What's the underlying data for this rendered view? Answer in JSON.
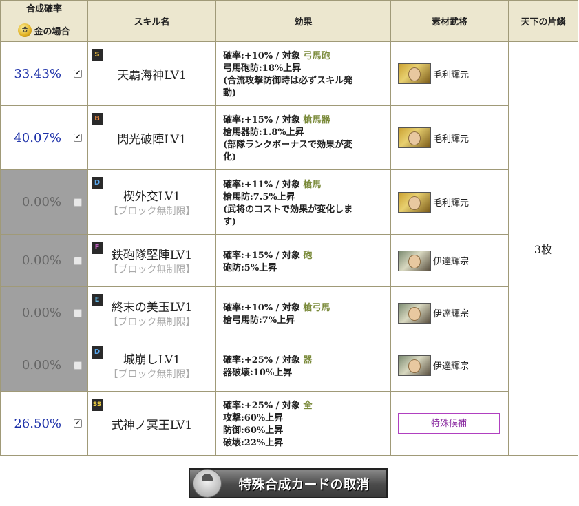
{
  "header": {
    "rate_title": "合成確率",
    "rate_gold": "金の場合",
    "gold_icon": "金",
    "skill_name": "スキル名",
    "effect": "効果",
    "material": "素材武将",
    "fragment": "天下の片鱗"
  },
  "fragment_value": "3枚",
  "rows": [
    {
      "rate": "33.43%",
      "checked": true,
      "rank": "S",
      "skill": "天覇海神LV1",
      "block_note": "",
      "effect": {
        "line1_prefix": "確率:+10% / 対象 ",
        "target": "弓馬砲",
        "lines": [
          "弓馬砲防:18%上昇",
          "(合流攻撃防御時は必ずスキル発",
          "動)"
        ]
      },
      "general": "毛利輝元"
    },
    {
      "rate": "40.07%",
      "checked": true,
      "rank": "B",
      "skill": "閃光破陣LV1",
      "block_note": "",
      "effect": {
        "line1_prefix": "確率:+15% / 対象 ",
        "target": "槍馬器",
        "lines": [
          "槍馬器防:1.8%上昇",
          "(部隊ランクボーナスで効果が変",
          "化)"
        ]
      },
      "general": "毛利輝元"
    },
    {
      "rate": "0.00%",
      "checked": false,
      "rank": "D",
      "skill": "楔外交LV1",
      "block_note": "【ブロック無制限】",
      "effect": {
        "line1_prefix": "確率:+11% / 対象 ",
        "target": "槍馬",
        "lines": [
          "槍馬防:7.5%上昇",
          "(武将のコストで効果が変化しま",
          "す)"
        ]
      },
      "general": "毛利輝元"
    },
    {
      "rate": "0.00%",
      "checked": false,
      "rank": "F",
      "skill": "鉄砲隊堅陣LV1",
      "block_note": "【ブロック無制限】",
      "effect": {
        "line1_prefix": "確率:+15% / 対象 ",
        "target": "砲",
        "lines": [
          "砲防:5%上昇"
        ]
      },
      "general": "伊達輝宗"
    },
    {
      "rate": "0.00%",
      "checked": false,
      "rank": "E",
      "skill": "終末の美玉LV1",
      "block_note": "【ブロック無制限】",
      "effect": {
        "line1_prefix": "確率:+10% / 対象 ",
        "target": "槍弓馬",
        "lines": [
          "槍弓馬防:7%上昇"
        ]
      },
      "general": "伊達輝宗"
    },
    {
      "rate": "0.00%",
      "checked": false,
      "rank": "D",
      "skill": "城崩しLV1",
      "block_note": "【ブロック無制限】",
      "effect": {
        "line1_prefix": "確率:+25% / 対象 ",
        "target": "器",
        "lines": [
          "器破壊:10%上昇"
        ]
      },
      "general": "伊達輝宗"
    },
    {
      "rate": "26.50%",
      "checked": true,
      "rank": "SS",
      "skill": "式神ノ冥王LV1",
      "block_note": "",
      "effect": {
        "line1_prefix": "確率:+25% / 対象 ",
        "target": "全",
        "lines": [
          "攻撃:60%上昇",
          "防御:60%上昇",
          "破壊:22%上昇"
        ]
      },
      "special_button": "特殊候補"
    }
  ],
  "cancel_button": "特殊合成カードの取消",
  "colors": {
    "rate_text": "#1a2ea8",
    "header_bg": "#ece7cf",
    "disabled_bg": "#a0a0a0",
    "target_text": "#7a8a3a",
    "special_border": "#b040c0"
  }
}
